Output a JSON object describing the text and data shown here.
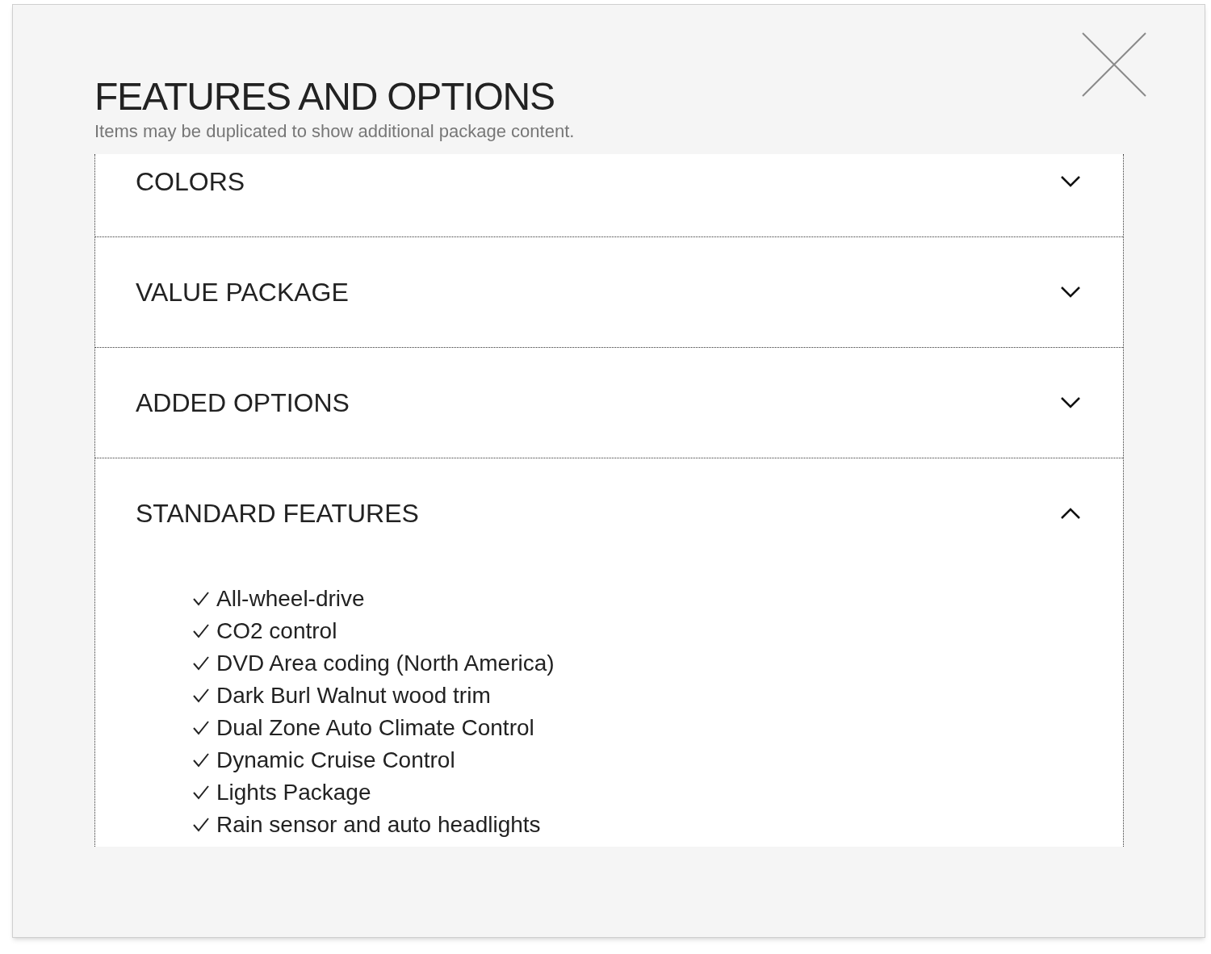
{
  "dialog": {
    "title": "FEATURES AND OPTIONS",
    "subtitle": "Items may be duplicated to show additional package content."
  },
  "sections": [
    {
      "title": "COLORS",
      "expanded": false
    },
    {
      "title": "VALUE PACKAGE",
      "expanded": false
    },
    {
      "title": "ADDED OPTIONS",
      "expanded": false
    },
    {
      "title": "STANDARD FEATURES",
      "expanded": true,
      "items": [
        "All-wheel-drive",
        "CO2 control",
        "DVD Area coding (North America)",
        "Dark Burl Walnut wood trim",
        "Dual Zone Auto Climate Control",
        "Dynamic Cruise Control",
        "Lights Package",
        "Rain sensor and auto headlights"
      ]
    }
  ]
}
